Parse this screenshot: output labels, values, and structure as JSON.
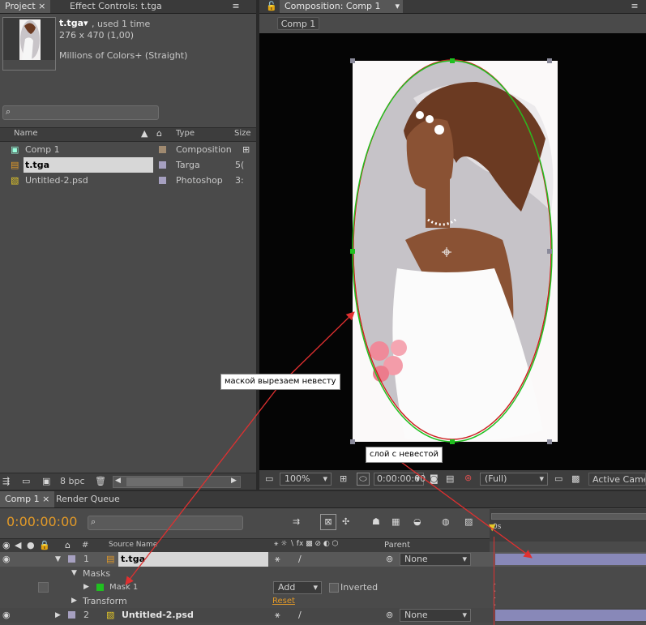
{
  "colors": {
    "panel": "#4a4a4a",
    "accent_orange": "#e39a28",
    "mask_green": "#20c020",
    "mask_red": "#cc2222",
    "annotation_arrow": "#e03030",
    "label_tan": "#a08a70",
    "label_lavender": "#a6a0c0",
    "layer_bar": "#8888b8"
  },
  "project": {
    "tab_label": "Project",
    "effect_tab_label": "Effect Controls: t.tga",
    "item_name": "t.tga",
    "usage": ", used 1 time",
    "dimensions": "276 x 470 (1,00)",
    "color_info": "Millions of Colors+ (Straight)",
    "search_placeholder": "",
    "columns": {
      "name": "Name",
      "type": "Type",
      "size": "Size"
    },
    "items": [
      {
        "name": "Comp 1",
        "type": "Composition",
        "size": "",
        "icon": "composition-icon",
        "label_color": "#a08a70"
      },
      {
        "name": "t.tga",
        "type": "Targa",
        "size": "5(",
        "icon": "footage-icon",
        "label_color": "#a6a0c0"
      },
      {
        "name": "Untitled-2.psd",
        "type": "Photoshop",
        "size": "3:",
        "icon": "photoshop-file-icon",
        "label_color": "#a6a0c0"
      }
    ],
    "bpc": "8 bpc"
  },
  "composition": {
    "tab_label": "Composition: Comp 1",
    "comp_button": "Comp 1",
    "zoom": "100%",
    "timecode": "0:00:00:00",
    "resolution": "(Full)",
    "camera": "Active Came"
  },
  "timeline": {
    "tab_comp": "Comp 1",
    "tab_render": "Render Queue",
    "timecode": "0:00:00:00",
    "col_num": "#",
    "col_source": "Source Name",
    "col_parent": "Parent",
    "ruler_label": "0s",
    "layers": [
      {
        "num": "1",
        "name": "t.tga",
        "parent": "None"
      },
      {
        "num": "2",
        "name": "Untitled-2.psd",
        "parent": "None"
      }
    ],
    "masks_label": "Masks",
    "mask1_label": "Mask 1",
    "mask_mode": "Add",
    "inverted_label": "Inverted",
    "transform_label": "Transform",
    "reset_label": "Reset"
  },
  "annotations": {
    "mask_note": "маской вырезаем невесту",
    "layer_note": "слой с невестой"
  }
}
